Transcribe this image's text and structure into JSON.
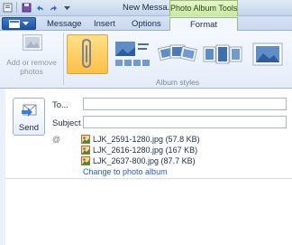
{
  "window": {
    "title": "New Messa..."
  },
  "context_tab": {
    "title": "Photo Album Tools"
  },
  "tabs": [
    {
      "label": "Message"
    },
    {
      "label": "Insert"
    },
    {
      "label": "Options"
    },
    {
      "label": "Format"
    }
  ],
  "ribbon": {
    "add_remove_label": "Add or remove photos",
    "group_label": "Album styles",
    "styles": [
      {
        "icon": "paperclip-icon",
        "selected": true
      },
      {
        "icon": "photo-grid-style-icon",
        "selected": false
      },
      {
        "icon": "photo-stack-style-icon",
        "selected": false
      },
      {
        "icon": "photo-strip-style-icon",
        "selected": false
      },
      {
        "icon": "photo-single-style-icon",
        "selected": false
      }
    ]
  },
  "compose": {
    "send_label": "Send",
    "to_label": "To...",
    "to_value": "",
    "subject_label": "Subject",
    "subject_value": "",
    "attachments": [
      "LJK_2591-1280.jpg (57.8 KB)",
      "LJK_2616-1280.jpg (167 KB)",
      "LJK_2637-800.jpg (87.7 KB)"
    ],
    "change_link": "Change to photo album"
  },
  "colors": {
    "accent": "#1f54a6",
    "selected_style": "#fbbf45",
    "context_green": "#98c26a",
    "link": "#1f5fbf"
  }
}
